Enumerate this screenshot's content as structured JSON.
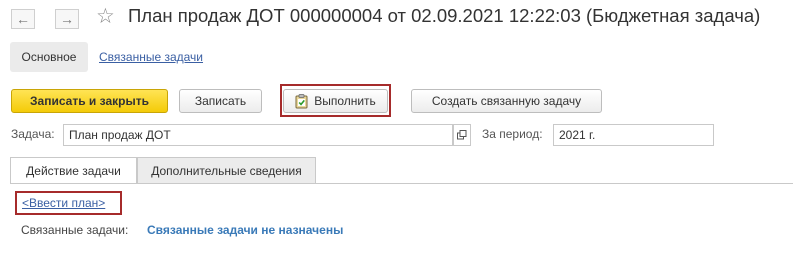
{
  "window": {
    "title": "План продаж ДОТ 000000004 от 02.09.2021 12:22:03 (Бюджетная задача)",
    "back_icon": "←",
    "forward_icon": "→",
    "favorite_icon": "☆"
  },
  "nav": {
    "tabs": [
      {
        "label": "Основное",
        "active": true
      },
      {
        "label": "Связанные задачи",
        "active": false
      }
    ]
  },
  "toolbar": {
    "save_close_label": "Записать и закрыть",
    "save_label": "Записать",
    "execute_label": "Выполнить",
    "create_related_label": "Создать связанную задачу"
  },
  "form": {
    "task_label": "Задача:",
    "task_value": "План продаж ДОТ",
    "period_label": "За период:",
    "period_value": "2021 г."
  },
  "panel_tabs": [
    {
      "label": "Действие задачи",
      "active": true
    },
    {
      "label": "Дополнительные сведения",
      "active": false
    }
  ],
  "content": {
    "enter_plan_link": "<Ввести план>",
    "related_label": "Связанные задачи:",
    "related_value": "Связанные задачи не назначены"
  },
  "colors": {
    "primary_button": "#f4cb08",
    "highlight_border": "#a62b2b",
    "link": "#3a5fa3",
    "status_text": "#3a7ab8"
  }
}
